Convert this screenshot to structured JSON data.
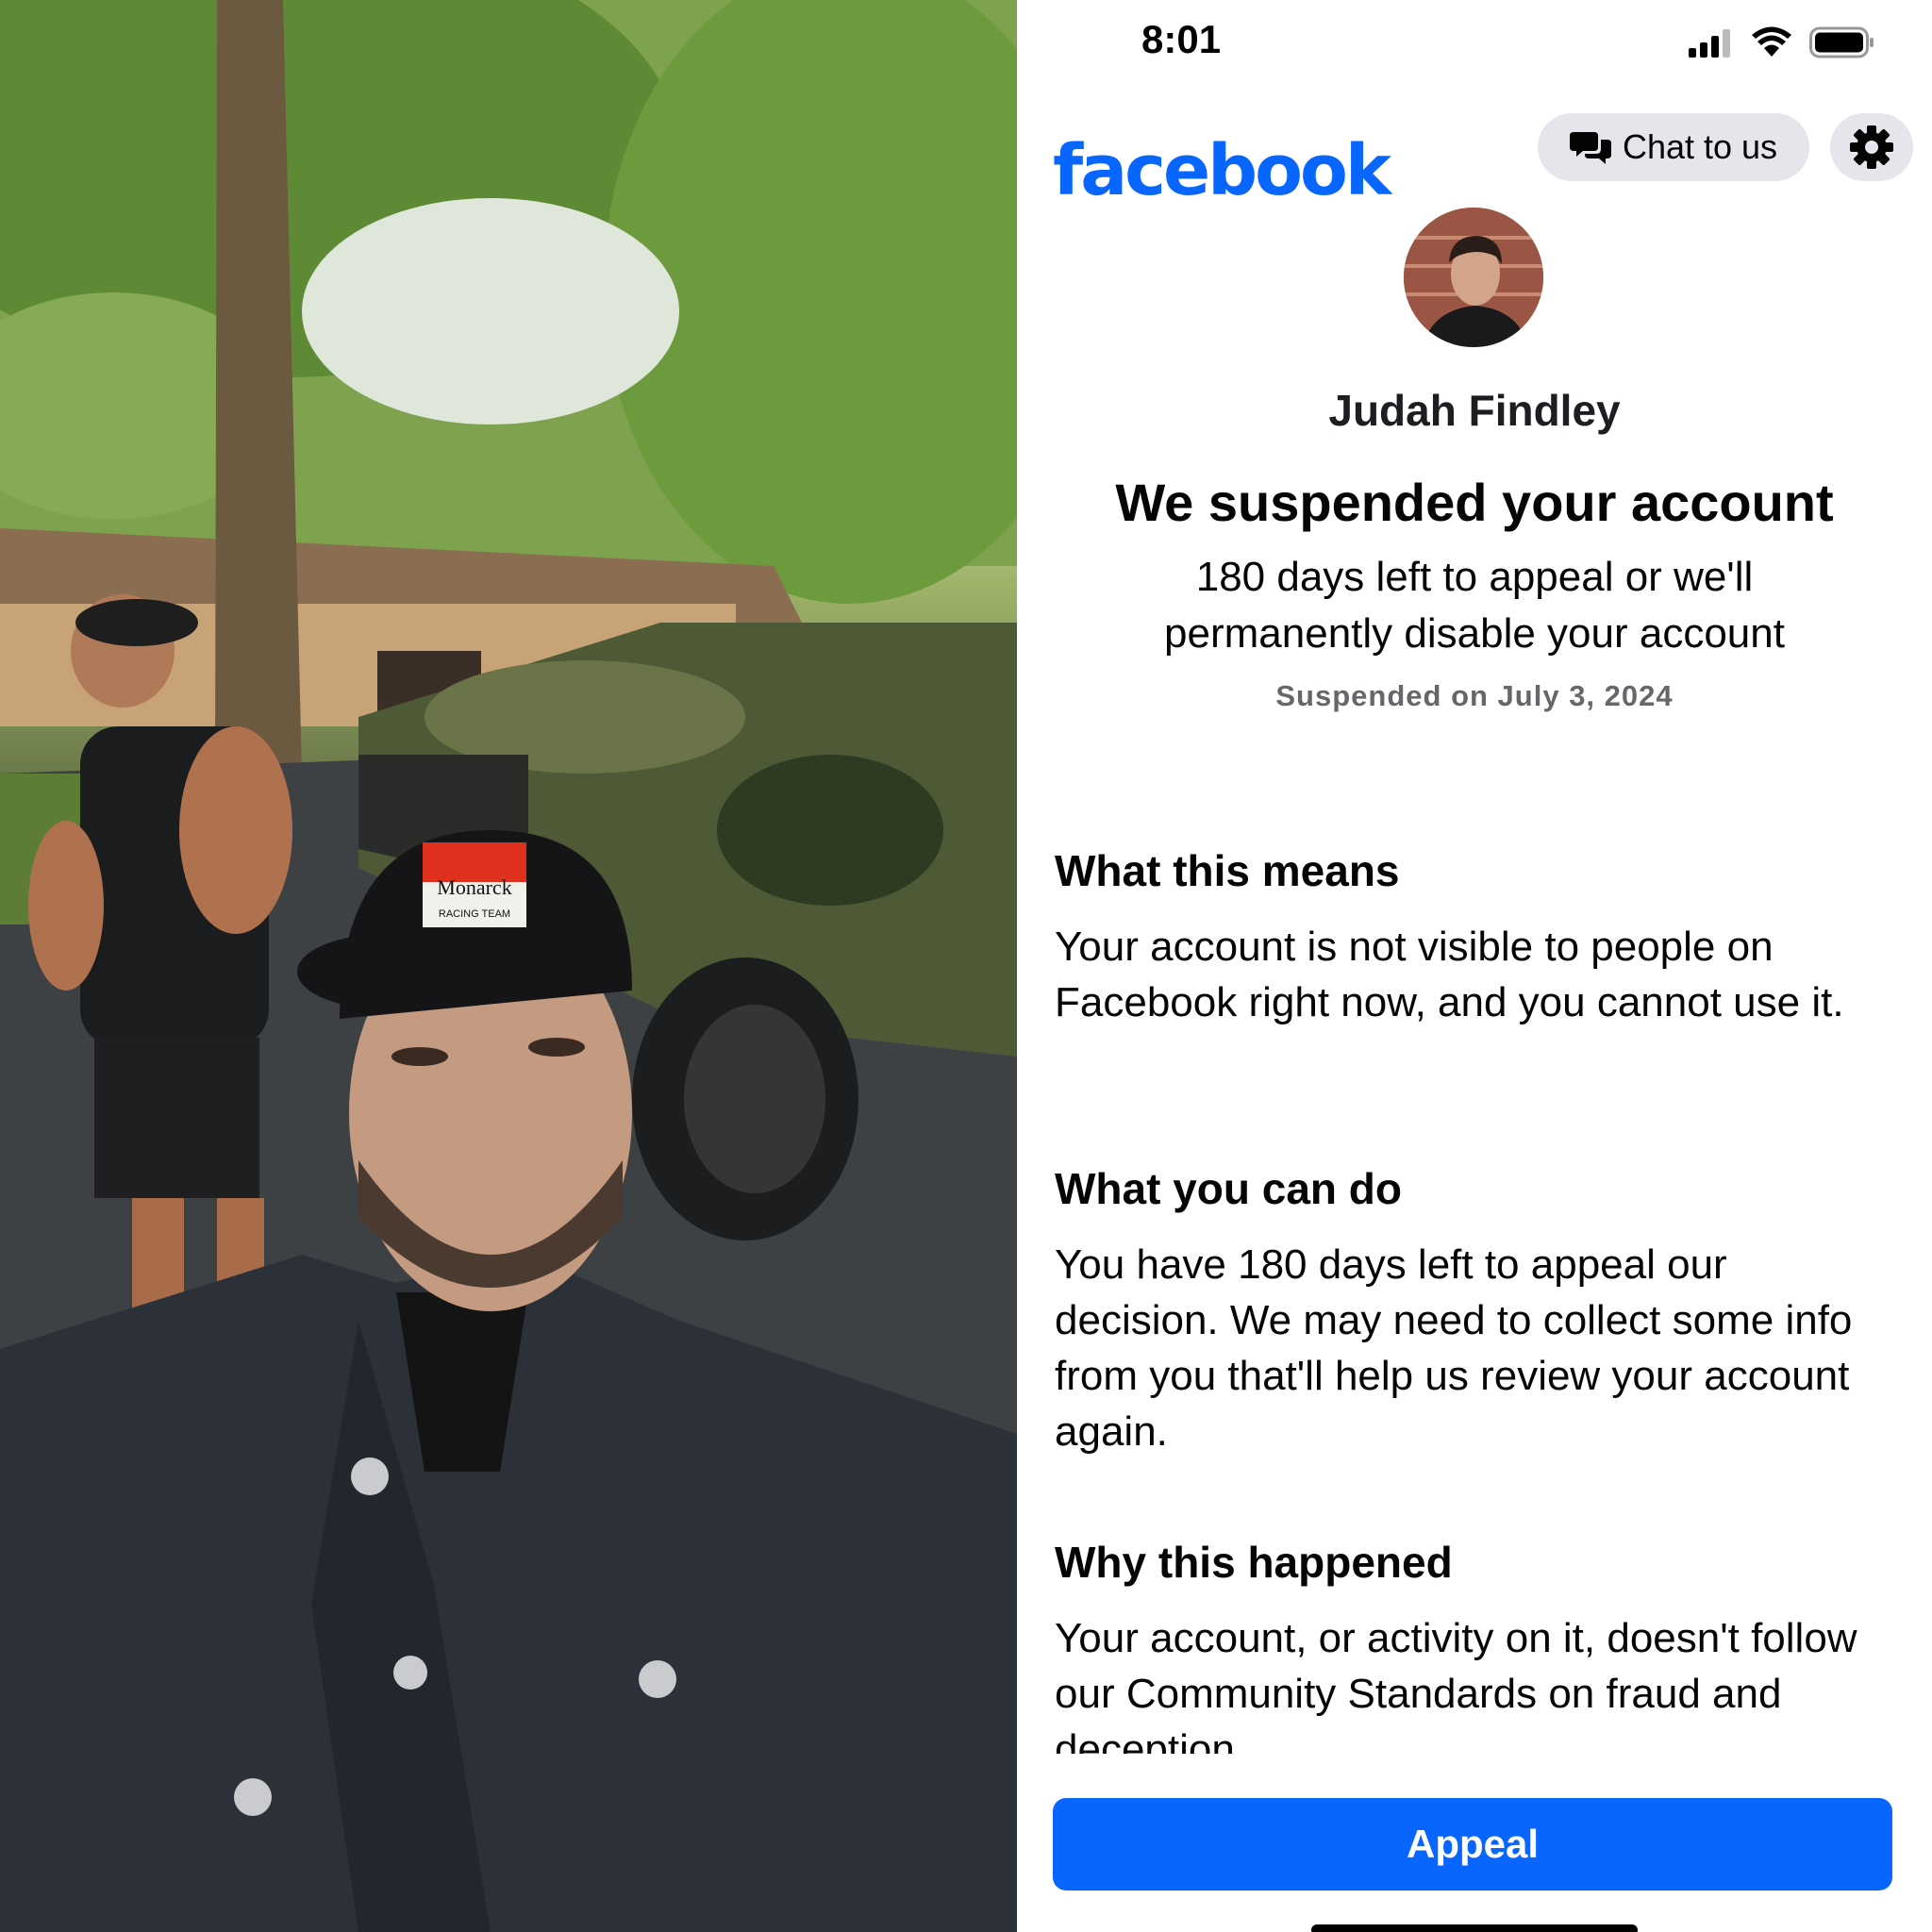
{
  "status_bar": {
    "time": "8:01",
    "icons": [
      "signal-icon",
      "wifi-icon",
      "battery-icon"
    ]
  },
  "header": {
    "logo_text": "facebook",
    "chat_button": {
      "icon": "chat-bubbles-icon",
      "label": "Chat to us"
    },
    "settings_icon": "gear-icon"
  },
  "profile": {
    "name": "Judah Findley"
  },
  "notice": {
    "title": "We suspended your account",
    "appeal_info": "180 days left to appeal or we'll permanently disable your account",
    "suspended_on": "Suspended on July 3, 2024"
  },
  "sections": [
    {
      "heading": "What this means",
      "body": "Your account is not visible to people on Facebook right now, and you cannot use it."
    },
    {
      "heading": "What you can do",
      "body": "You have 180 days left to appeal our decision. We may need to collect some info from you that'll help us review your account again."
    },
    {
      "heading": "Why this happened",
      "body": "Your account, or activity on it, doesn't follow our Community Standards on fraud and deception."
    }
  ],
  "appeal_button": {
    "label": "Appeal"
  },
  "photo": {
    "cap_text": "Monarck",
    "cap_subtext": "RACING TEAM"
  },
  "colors": {
    "brand_blue": "#0866ff",
    "button_gray": "#e4e6eb",
    "muted_text": "#65676b"
  }
}
